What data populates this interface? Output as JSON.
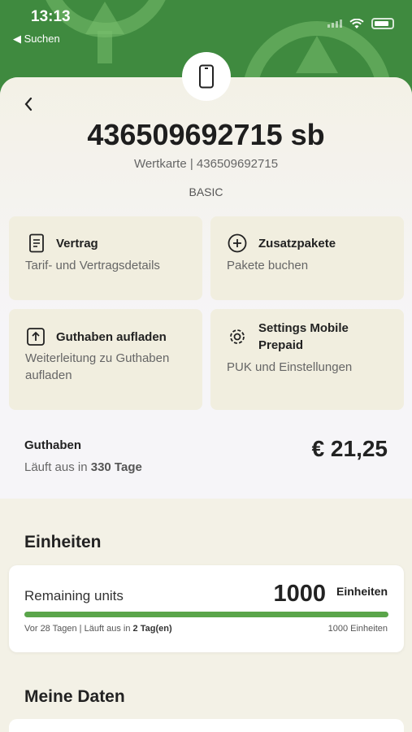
{
  "status_bar": {
    "time": "13:13",
    "back_label": "◀ Suchen"
  },
  "header": {
    "back_icon": "chevron-left-icon",
    "number": "436509692715 sb",
    "subtitle": "Wertkarte | 436509692715",
    "plan": "BASIC",
    "badge_icon": "phone-icon"
  },
  "tiles": [
    {
      "title": "Vertrag",
      "description": "Tarif- und Vertragsdetails",
      "icon": "document-icon"
    },
    {
      "title": "Zusatzpakete",
      "description": "Pakete buchen",
      "icon": "plus-circle-icon"
    },
    {
      "title": "Guthaben aufladen",
      "description": "Weiterleitung zu Guthaben aufladen",
      "icon": "upload-icon"
    },
    {
      "title": "Settings Mobile Prepaid",
      "description": "PUK und Einstellungen",
      "icon": "gear-icon"
    }
  ],
  "balance": {
    "label": "Guthaben",
    "expiry_prefix": "Läuft aus in ",
    "expiry_days": "330 Tage",
    "amount": "€ 21,25"
  },
  "units_section": {
    "title": "Einheiten",
    "card": {
      "label": "Remaining units",
      "value": "1000",
      "unit": "Einheiten",
      "progress_fraction": 1.0,
      "meta_prefix": "Vor 28 Tagen | Läuft aus in ",
      "meta_days": "2 Tag(en)",
      "total": "1000 Einheiten"
    }
  },
  "data_section": {
    "title": "Meine Daten"
  },
  "colors": {
    "brand_green": "#3f8a3f",
    "progress_green": "#5aa54a",
    "tile_background": "#f1eedf"
  }
}
